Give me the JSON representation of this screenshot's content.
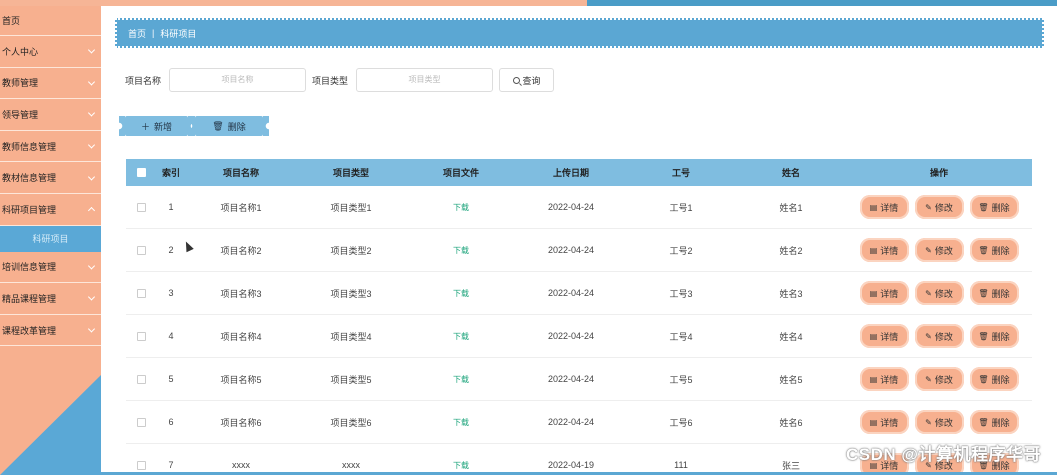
{
  "sidebar": {
    "items": [
      {
        "label": "首页",
        "has_arrow": false
      },
      {
        "label": "个人中心",
        "has_arrow": true
      },
      {
        "label": "教师管理",
        "has_arrow": true
      },
      {
        "label": "领导管理",
        "has_arrow": true
      },
      {
        "label": "教师信息管理",
        "has_arrow": true
      },
      {
        "label": "教材信息管理",
        "has_arrow": true
      },
      {
        "label": "科研项目管理",
        "has_arrow": true
      },
      {
        "label": "科研项目",
        "submenu": true
      },
      {
        "label": "培训信息管理",
        "has_arrow": true
      },
      {
        "label": "精品课程管理",
        "has_arrow": true
      },
      {
        "label": "课程改革管理",
        "has_arrow": true
      }
    ],
    "accent_color": "#f7b08f",
    "active_color": "#5aa8d6"
  },
  "breadcrumb": {
    "home": "首页",
    "separator": "|",
    "current": "科研项目"
  },
  "search": {
    "name_label": "项目名称",
    "name_placeholder": "项目名称",
    "type_label": "项目类型",
    "type_placeholder": "项目类型",
    "button_label": "查询"
  },
  "actions": {
    "add_label": "新增",
    "delete_label": "删除"
  },
  "table": {
    "headers": {
      "index": "索引",
      "name": "项目名称",
      "type": "项目类型",
      "file": "项目文件",
      "date": "上传日期",
      "work_no": "工号",
      "person": "姓名",
      "ops": "操作"
    },
    "rows": [
      {
        "index": "1",
        "name": "项目名称1",
        "type": "项目类型1",
        "file": "下载",
        "date": "2022-04-24",
        "work_no": "工号1",
        "person": "姓名1"
      },
      {
        "index": "2",
        "name": "项目名称2",
        "type": "项目类型2",
        "file": "下载",
        "date": "2022-04-24",
        "work_no": "工号2",
        "person": "姓名2"
      },
      {
        "index": "3",
        "name": "项目名称3",
        "type": "项目类型3",
        "file": "下载",
        "date": "2022-04-24",
        "work_no": "工号3",
        "person": "姓名3"
      },
      {
        "index": "4",
        "name": "项目名称4",
        "type": "项目类型4",
        "file": "下载",
        "date": "2022-04-24",
        "work_no": "工号4",
        "person": "姓名4"
      },
      {
        "index": "5",
        "name": "项目名称5",
        "type": "项目类型5",
        "file": "下载",
        "date": "2022-04-24",
        "work_no": "工号5",
        "person": "姓名5"
      },
      {
        "index": "6",
        "name": "项目名称6",
        "type": "项目类型6",
        "file": "下载",
        "date": "2022-04-24",
        "work_no": "工号6",
        "person": "姓名6"
      },
      {
        "index": "7",
        "name": "xxxx",
        "type": "xxxx",
        "file": "下载",
        "date": "2022-04-19",
        "work_no": "111",
        "person": "张三"
      }
    ],
    "op_labels": {
      "detail": "详情",
      "edit": "修改",
      "delete": "删除"
    },
    "header_color": "#7fbde0",
    "download_color": "#1aa37a"
  },
  "watermark": "CSDN @计算机程序华哥"
}
